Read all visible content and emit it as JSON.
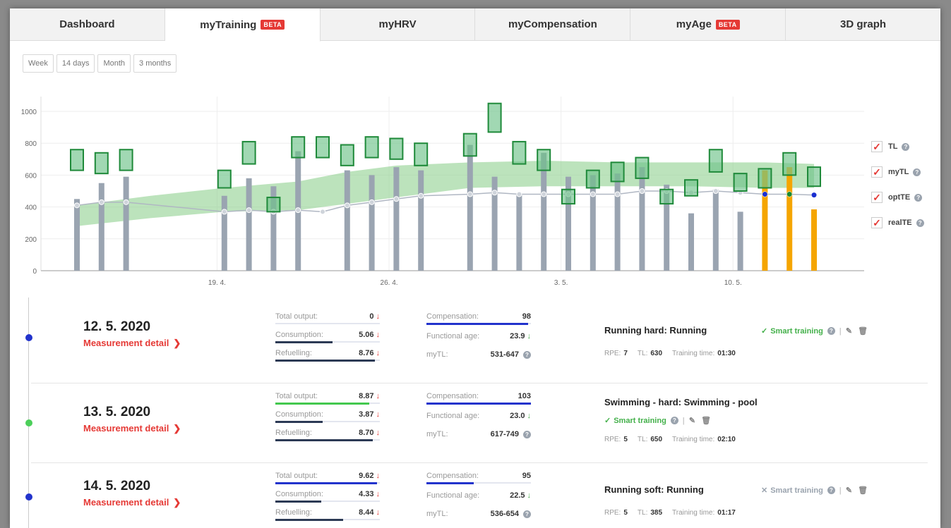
{
  "tabs": [
    {
      "label": "Dashboard",
      "beta": ""
    },
    {
      "label": "myTraining",
      "beta": "BETA"
    },
    {
      "label": "myHRV",
      "beta": ""
    },
    {
      "label": "myCompensation",
      "beta": ""
    },
    {
      "label": "myAge",
      "beta": "BETA"
    },
    {
      "label": "3D graph",
      "beta": ""
    }
  ],
  "active_tab": "myTraining",
  "ranges": [
    "Week",
    "14 days",
    "Month",
    "3 months"
  ],
  "legend": [
    "TL",
    "myTL",
    "optTE",
    "realTE"
  ],
  "chart_data": {
    "type": "bar",
    "yticks": [
      "1000",
      "800",
      "600",
      "400",
      "200",
      "0"
    ],
    "ylim": [
      0,
      1100
    ],
    "xticks": [
      "19. 4.",
      "26. 4.",
      "3. 5.",
      "10. 5."
    ],
    "tl_bars": [
      {
        "day": 0,
        "v": 450,
        "color": "gray"
      },
      {
        "day": 1,
        "v": 550,
        "color": "gray"
      },
      {
        "day": 2,
        "v": 590,
        "color": "gray"
      },
      {
        "day": 6,
        "v": 470,
        "color": "gray"
      },
      {
        "day": 7,
        "v": 580,
        "color": "gray"
      },
      {
        "day": 8,
        "v": 530,
        "color": "gray"
      },
      {
        "day": 9,
        "v": 750,
        "color": "gray"
      },
      {
        "day": 11,
        "v": 630,
        "color": "gray"
      },
      {
        "day": 12,
        "v": 600,
        "color": "gray"
      },
      {
        "day": 13,
        "v": 650,
        "color": "gray"
      },
      {
        "day": 14,
        "v": 630,
        "color": "gray"
      },
      {
        "day": 16,
        "v": 790,
        "color": "gray"
      },
      {
        "day": 17,
        "v": 590,
        "color": "gray"
      },
      {
        "day": 18,
        "v": 480,
        "color": "gray"
      },
      {
        "day": 19,
        "v": 740,
        "color": "gray"
      },
      {
        "day": 20,
        "v": 590,
        "color": "gray"
      },
      {
        "day": 21,
        "v": 600,
        "color": "gray"
      },
      {
        "day": 22,
        "v": 610,
        "color": "gray"
      },
      {
        "day": 23,
        "v": 650,
        "color": "gray"
      },
      {
        "day": 24,
        "v": 540,
        "color": "gray"
      },
      {
        "day": 25,
        "v": 360,
        "color": "gray"
      },
      {
        "day": 26,
        "v": 510,
        "color": "gray"
      },
      {
        "day": 27,
        "v": 370,
        "color": "gray"
      },
      {
        "day": 28,
        "v": 630,
        "color": "orange"
      },
      {
        "day": 29,
        "v": 650,
        "color": "orange"
      },
      {
        "day": 30,
        "v": 385,
        "color": "orange"
      }
    ],
    "mytl_boxes": [
      {
        "day": 0,
        "lo": 630,
        "hi": 760
      },
      {
        "day": 1,
        "lo": 610,
        "hi": 740
      },
      {
        "day": 2,
        "lo": 630,
        "hi": 760
      },
      {
        "day": 6,
        "lo": 520,
        "hi": 630
      },
      {
        "day": 7,
        "lo": 670,
        "hi": 810
      },
      {
        "day": 8,
        "lo": 370,
        "hi": 460
      },
      {
        "day": 9,
        "lo": 710,
        "hi": 840
      },
      {
        "day": 10,
        "lo": 710,
        "hi": 840
      },
      {
        "day": 11,
        "lo": 660,
        "hi": 790
      },
      {
        "day": 12,
        "lo": 710,
        "hi": 840
      },
      {
        "day": 13,
        "lo": 700,
        "hi": 830
      },
      {
        "day": 14,
        "lo": 660,
        "hi": 800
      },
      {
        "day": 16,
        "lo": 720,
        "hi": 860
      },
      {
        "day": 17,
        "lo": 870,
        "hi": 1050
      },
      {
        "day": 18,
        "lo": 670,
        "hi": 810
      },
      {
        "day": 19,
        "lo": 630,
        "hi": 760
      },
      {
        "day": 20,
        "lo": 420,
        "hi": 510
      },
      {
        "day": 21,
        "lo": 520,
        "hi": 630
      },
      {
        "day": 22,
        "lo": 560,
        "hi": 680
      },
      {
        "day": 23,
        "lo": 580,
        "hi": 710
      },
      {
        "day": 24,
        "lo": 420,
        "hi": 510
      },
      {
        "day": 25,
        "lo": 470,
        "hi": 570
      },
      {
        "day": 26,
        "lo": 620,
        "hi": 760
      },
      {
        "day": 27,
        "lo": 500,
        "hi": 610
      },
      {
        "day": 28,
        "lo": 520,
        "hi": 640
      },
      {
        "day": 29,
        "lo": 600,
        "hi": 740
      },
      {
        "day": 30,
        "lo": 530,
        "hi": 650
      }
    ],
    "opt_band": [
      {
        "day": 0,
        "lo": 280,
        "hi": 410
      },
      {
        "day": 3,
        "lo": 330,
        "hi": 470
      },
      {
        "day": 6,
        "lo": 370,
        "hi": 520
      },
      {
        "day": 9,
        "lo": 380,
        "hi": 560
      },
      {
        "day": 11,
        "lo": 420,
        "hi": 620
      },
      {
        "day": 13,
        "lo": 460,
        "hi": 660
      },
      {
        "day": 16,
        "lo": 520,
        "hi": 680
      },
      {
        "day": 19,
        "lo": 530,
        "hi": 690
      },
      {
        "day": 22,
        "lo": 530,
        "hi": 680
      },
      {
        "day": 25,
        "lo": 530,
        "hi": 680
      },
      {
        "day": 28,
        "lo": 520,
        "hi": 680
      },
      {
        "day": 30,
        "lo": 520,
        "hi": 670
      }
    ],
    "real_te": [
      {
        "day": 0,
        "v": 410
      },
      {
        "day": 1,
        "v": 430
      },
      {
        "day": 2,
        "v": 430
      },
      {
        "day": 6,
        "v": 370
      },
      {
        "day": 7,
        "v": 380
      },
      {
        "day": 8,
        "v": 370
      },
      {
        "day": 9,
        "v": 380
      },
      {
        "day": 10,
        "v": 370
      },
      {
        "day": 11,
        "v": 410
      },
      {
        "day": 12,
        "v": 430
      },
      {
        "day": 13,
        "v": 450
      },
      {
        "day": 14,
        "v": 470
      },
      {
        "day": 16,
        "v": 480
      },
      {
        "day": 17,
        "v": 490
      },
      {
        "day": 18,
        "v": 480
      },
      {
        "day": 19,
        "v": 480
      },
      {
        "day": 20,
        "v": 480
      },
      {
        "day": 21,
        "v": 480
      },
      {
        "day": 22,
        "v": 480
      },
      {
        "day": 23,
        "v": 500
      },
      {
        "day": 24,
        "v": 500
      },
      {
        "day": 25,
        "v": 490
      },
      {
        "day": 26,
        "v": 500
      },
      {
        "day": 27,
        "v": 490
      },
      {
        "day": 28,
        "v": 480
      },
      {
        "day": 29,
        "v": 480
      },
      {
        "day": 30,
        "v": 475
      }
    ],
    "colored_points": [
      {
        "day": 28,
        "v": 480,
        "color": "#1a2fd0"
      },
      {
        "day": 29,
        "v": 480,
        "color": "#1b8a2e"
      },
      {
        "day": 30,
        "v": 475,
        "color": "#1a2fd0"
      }
    ]
  },
  "entries": [
    {
      "date": "12. 5. 2020",
      "detail": "Measurement detail",
      "dot_color": "#2233cc",
      "total_output": {
        "label": "Total output:",
        "value": "0",
        "bar": 0,
        "color": "#2233cc"
      },
      "consumption": {
        "label": "Consumption:",
        "value": "5.06",
        "bar": 0.55,
        "color": "#2c3a55"
      },
      "refuelling": {
        "label": "Refuelling:",
        "value": "8.76",
        "bar": 0.95,
        "color": "#2c3a55"
      },
      "compensation": {
        "label": "Compensation:",
        "value": "98",
        "bar": 0.97
      },
      "functional_age": {
        "label": "Functional age:",
        "value": "23.9"
      },
      "mytl": {
        "label": "myTL:",
        "value": "531-647"
      },
      "training": "Running hard: Running",
      "smart_ok": true,
      "smart_label": "Smart training",
      "rpe_label": "RPE:",
      "rpe": "7",
      "tl_label": "TL:",
      "tl": "630",
      "time_label": "Training time:",
      "time": "01:30"
    },
    {
      "date": "13. 5. 2020",
      "detail": "Measurement detail",
      "dot_color": "#4ccf5a",
      "total_output": {
        "label": "Total output:",
        "value": "8.87",
        "bar": 0.9,
        "color": "#43c84e"
      },
      "consumption": {
        "label": "Consumption:",
        "value": "3.87",
        "bar": 0.45,
        "color": "#2c3a55"
      },
      "refuelling": {
        "label": "Refuelling:",
        "value": "8.70",
        "bar": 0.93,
        "color": "#2c3a55"
      },
      "compensation": {
        "label": "Compensation:",
        "value": "103",
        "bar": 1
      },
      "functional_age": {
        "label": "Functional age:",
        "value": "23.0"
      },
      "mytl": {
        "label": "myTL:",
        "value": "617-749"
      },
      "training": "Swimming - hard: Swimming - pool",
      "smart_ok": true,
      "smart_label": "Smart training",
      "rpe_label": "RPE:",
      "rpe": "5",
      "tl_label": "TL:",
      "tl": "650",
      "time_label": "Training time:",
      "time": "02:10"
    },
    {
      "date": "14. 5. 2020",
      "detail": "Measurement detail",
      "dot_color": "#2233cc",
      "total_output": {
        "label": "Total output:",
        "value": "9.62",
        "bar": 0.97,
        "color": "#2233cc"
      },
      "consumption": {
        "label": "Consumption:",
        "value": "4.33",
        "bar": 0.44,
        "color": "#2c3a55"
      },
      "refuelling": {
        "label": "Refuelling:",
        "value": "8.44",
        "bar": 0.65,
        "color": "#2c3a55"
      },
      "compensation": {
        "label": "Compensation:",
        "value": "95",
        "bar": 0.45
      },
      "functional_age": {
        "label": "Functional age:",
        "value": "22.5"
      },
      "mytl": {
        "label": "myTL:",
        "value": "536-654"
      },
      "training": "Running soft: Running",
      "smart_ok": false,
      "smart_label": "Smart training",
      "rpe_label": "RPE:",
      "rpe": "5",
      "tl_label": "TL:",
      "tl": "385",
      "time_label": "Training time:",
      "time": "01:17"
    }
  ]
}
